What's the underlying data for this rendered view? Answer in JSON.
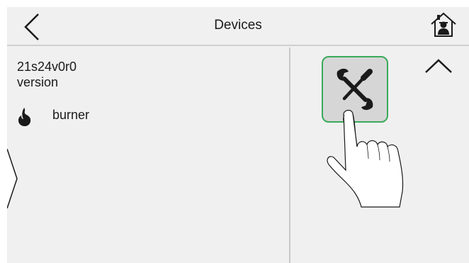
{
  "header": {
    "title": "Devices",
    "back_icon": "chevron-left-icon",
    "home_icon": "home-user-icon"
  },
  "device": {
    "name": "21s24v0r0",
    "version_label": "version",
    "items": [
      {
        "label": "burner",
        "icon": "flame-icon"
      }
    ]
  },
  "right_panel": {
    "tools_icon": "tools-icon",
    "collapse_icon": "chevron-up-icon",
    "pointer_icon": "pointing-hand-icon"
  },
  "colors": {
    "background": "#f0f0f0",
    "divider": "#c8c8c8",
    "tools_border": "#3aaa5a",
    "tools_fill": "#d6d6d6",
    "text": "#1a1a1a"
  }
}
